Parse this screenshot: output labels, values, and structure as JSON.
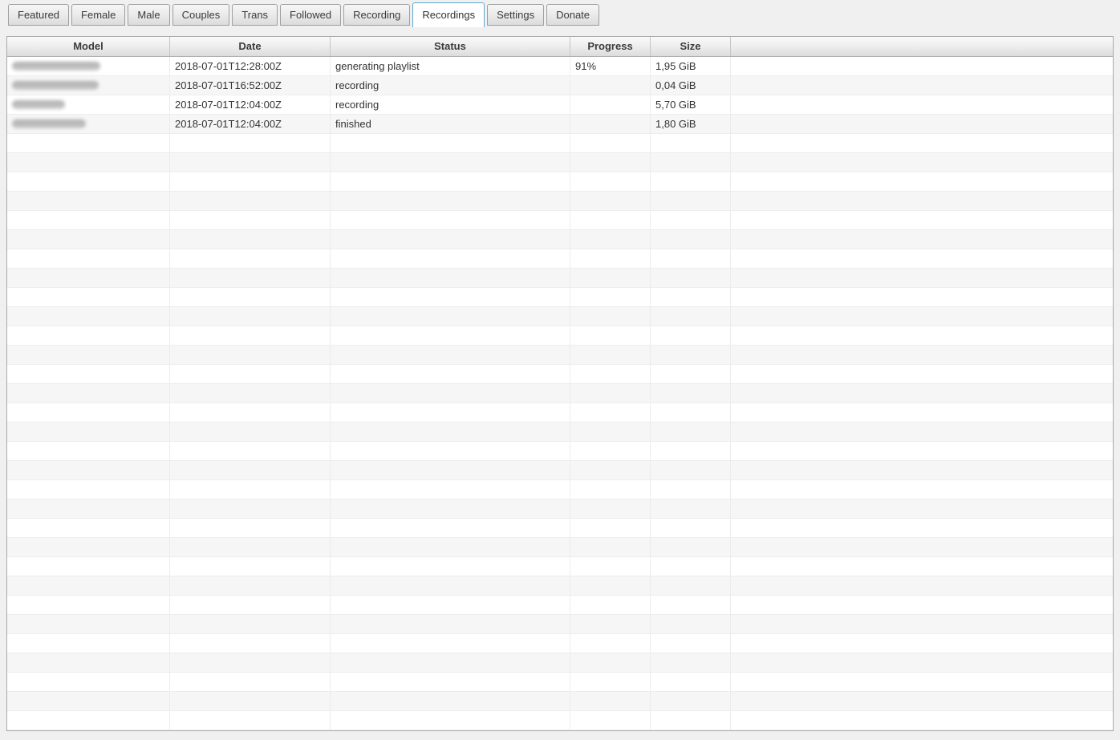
{
  "tabs": {
    "items": [
      {
        "label": "Featured",
        "selected": false
      },
      {
        "label": "Female",
        "selected": false
      },
      {
        "label": "Male",
        "selected": false
      },
      {
        "label": "Couples",
        "selected": false
      },
      {
        "label": "Trans",
        "selected": false
      },
      {
        "label": "Followed",
        "selected": false
      },
      {
        "label": "Recording",
        "selected": false
      },
      {
        "label": "Recordings",
        "selected": true
      },
      {
        "label": "Settings",
        "selected": false
      },
      {
        "label": "Donate",
        "selected": false
      }
    ]
  },
  "table": {
    "columns": [
      "Model",
      "Date",
      "Status",
      "Progress",
      "Size",
      ""
    ],
    "rows": [
      {
        "model_redacted": true,
        "model_blur_width": 110,
        "date": "2018-07-01T12:28:00Z",
        "status": "generating playlist",
        "progress": "91%",
        "size": "1,95 GiB"
      },
      {
        "model_redacted": true,
        "model_blur_width": 108,
        "date": "2018-07-01T16:52:00Z",
        "status": "recording",
        "progress": "",
        "size": "0,04 GiB"
      },
      {
        "model_redacted": true,
        "model_blur_width": 66,
        "date": "2018-07-01T12:04:00Z",
        "status": "recording",
        "progress": "",
        "size": "5,70 GiB"
      },
      {
        "model_redacted": true,
        "model_blur_width": 92,
        "date": "2018-07-01T12:04:00Z",
        "status": "finished",
        "progress": "",
        "size": "1,80 GiB"
      }
    ],
    "empty_row_count": 31
  },
  "colors": {
    "window_bg": "#f0f0f0",
    "selected_tab_border": "#5fa8d5",
    "row_alt_bg": "#f6f6f6",
    "table_border": "#a9a9a9",
    "header_text": "#3c3c3c"
  }
}
